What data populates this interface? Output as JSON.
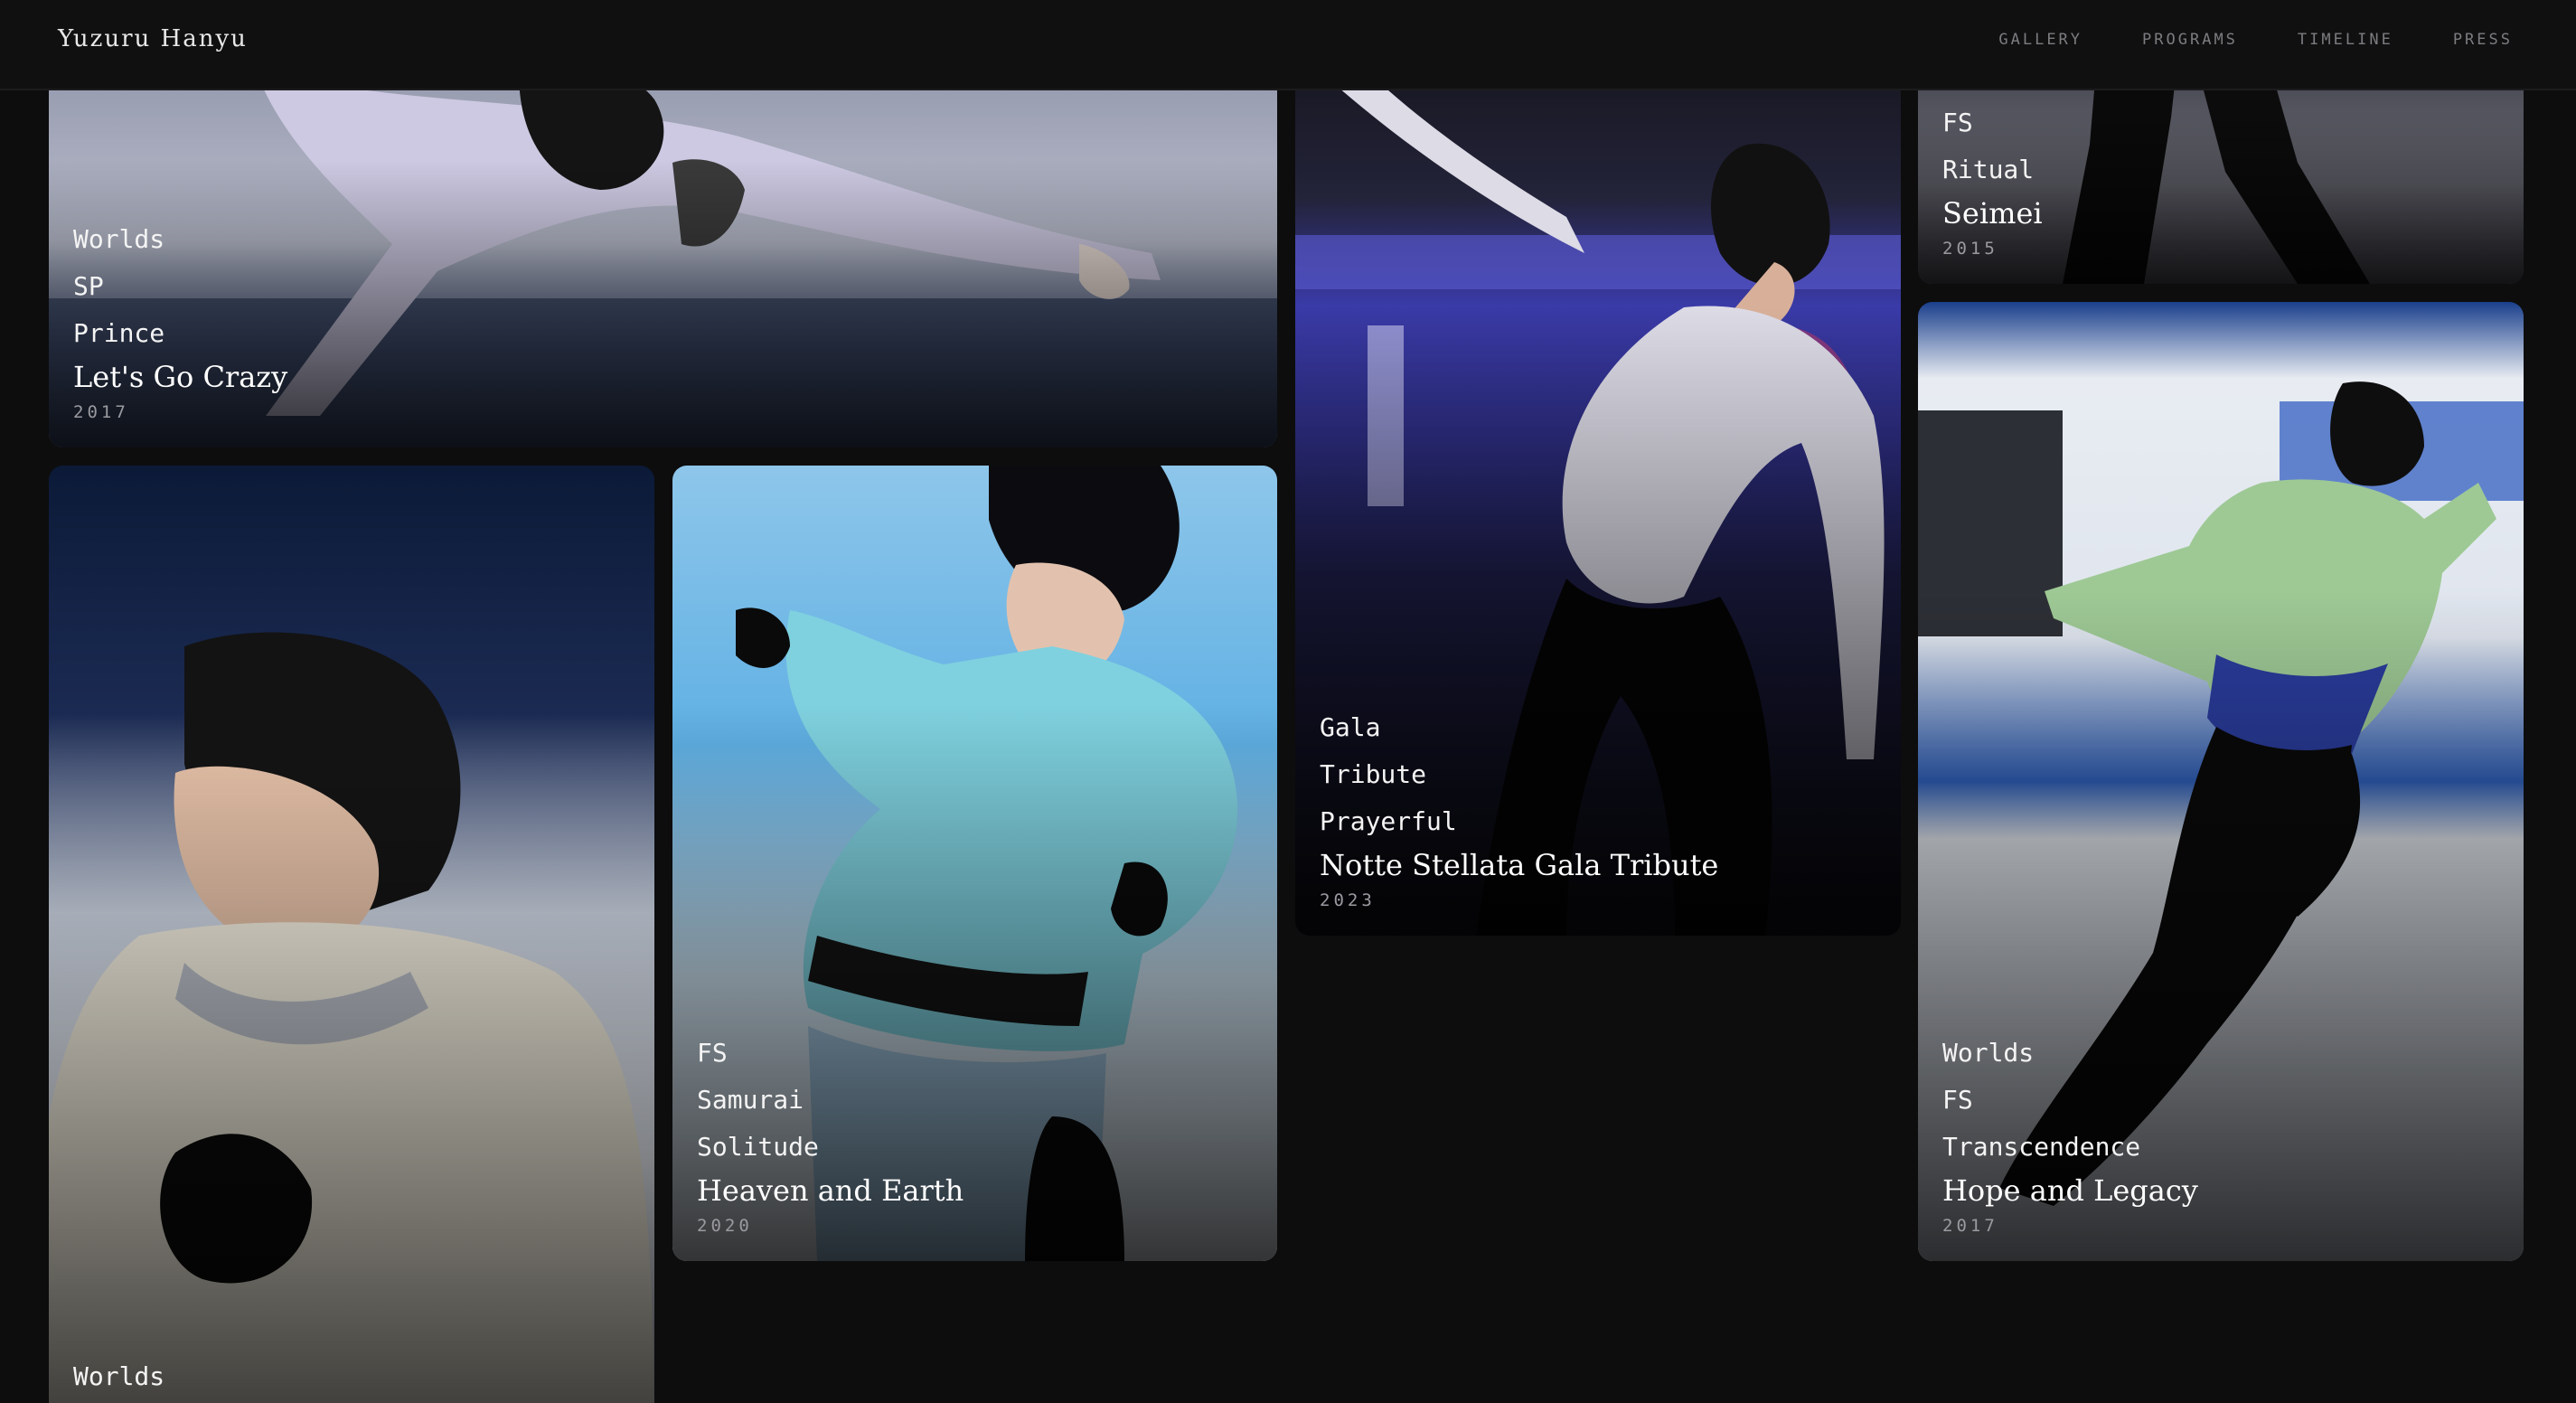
{
  "nav": {
    "brand": "Yuzuru Hanyu",
    "links": [
      "GALLERY",
      "PROGRAMS",
      "TIMELINE",
      "PRESS"
    ]
  },
  "cards": {
    "prince": {
      "tags": [
        "Worlds",
        "SP",
        "Prince"
      ],
      "title": "Let's Go Crazy",
      "year": "2017"
    },
    "seimei": {
      "tags": [
        "FS",
        "Ritual"
      ],
      "title": "Seimei",
      "year": "2015"
    },
    "gala": {
      "tags": [
        "Gala",
        "Tribute",
        "Prayerful"
      ],
      "title": "Notte Stellata Gala Tribute",
      "year": "2023"
    },
    "heaven": {
      "tags": [
        "FS",
        "Samurai",
        "Solitude"
      ],
      "title": "Heaven and Earth",
      "year": "2020"
    },
    "hope": {
      "tags": [
        "Worlds",
        "FS",
        "Transcendence"
      ],
      "title": "Hope and Legacy",
      "year": "2017"
    },
    "worlds_portrait": {
      "tags": [
        "Worlds"
      ]
    }
  },
  "colors": {
    "background": "#0d0d0e",
    "navbar": "#101011",
    "nav_text": "#7c7c80",
    "caption_text": "#f4f4f4",
    "year_text": "#9a9aa0"
  }
}
